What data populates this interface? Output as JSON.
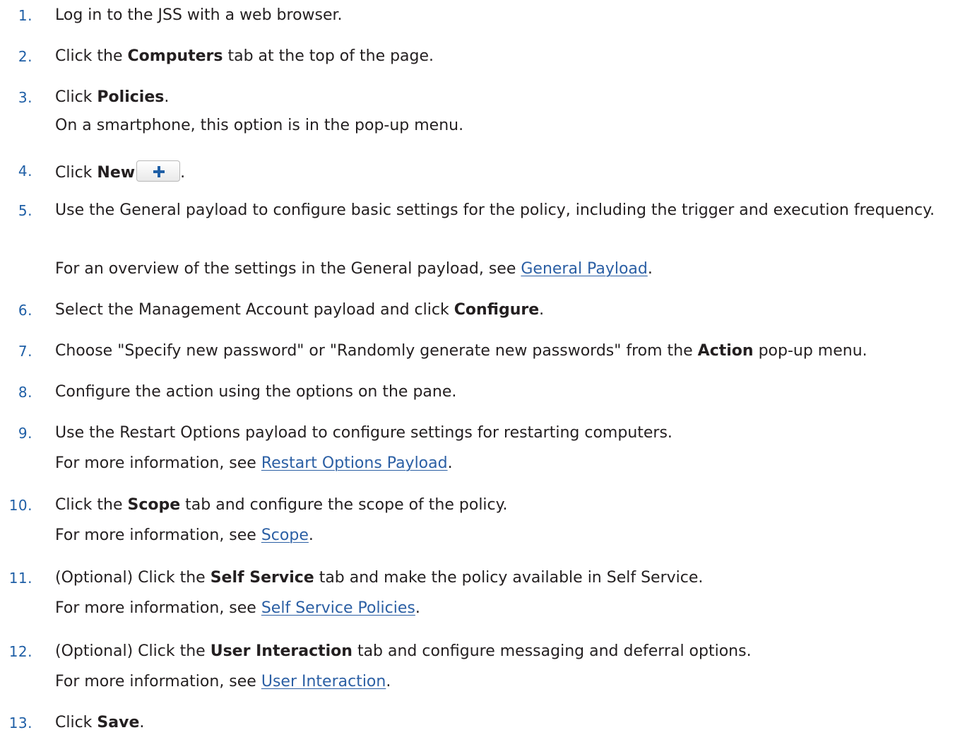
{
  "steps": [
    {
      "num": "1.",
      "text": "Log in to the JSS with a web browser."
    },
    {
      "num": "2.",
      "pre": "Click the ",
      "bold": "Computers",
      "post": " tab at the top of the page."
    },
    {
      "num": "3.",
      "pre": "Click ",
      "bold": "Policies",
      "post": ".",
      "note": "On a smartphone, this option is in the pop-up menu."
    },
    {
      "num": "4.",
      "pre": "Click ",
      "bold": "New",
      "post": ".",
      "icon": "plus-icon"
    },
    {
      "num": "5.",
      "text": "Use the General payload to configure basic settings for the policy, including the trigger and execution frequency.",
      "note_pre": "For an overview of the settings in the General payload, see ",
      "note_link": "General Payload",
      "note_post": "."
    },
    {
      "num": "6.",
      "pre": "Select the Management Account payload and click ",
      "bold": "Configure",
      "post": "."
    },
    {
      "num": "7.",
      "pre": "Choose \"Specify new password\" or \"Randomly generate new passwords\" from the ",
      "bold": "Action",
      "post": " pop-up menu."
    },
    {
      "num": "8.",
      "text": "Configure the action using the options on the pane."
    },
    {
      "num": "9.",
      "text": "Use the Restart Options payload to configure settings for restarting computers.",
      "note_pre": "For more information, see ",
      "note_link": "Restart Options Payload",
      "note_post": "."
    },
    {
      "num": "10.",
      "pre": "Click the ",
      "bold": "Scope",
      "post": " tab and configure the scope of the policy.",
      "note_pre": "For more information, see ",
      "note_link": "Scope",
      "note_post": "."
    },
    {
      "num": "11.",
      "pre": "(Optional) Click the ",
      "bold": "Self Service",
      "post": " tab and make the policy available in Self Service.",
      "note_pre": "For more information, see ",
      "note_link": "Self Service Policies",
      "note_post": "."
    },
    {
      "num": "12.",
      "pre": "(Optional) Click the ",
      "bold": "User Interaction",
      "post": " tab and configure messaging and deferral options.",
      "note_pre": "For more information, see ",
      "note_link": "User Interaction",
      "note_post": "."
    },
    {
      "num": "13.",
      "pre": "Click ",
      "bold": "Save",
      "post": "."
    }
  ],
  "colors": {
    "text": "#231f20",
    "number": "#1f5fa6",
    "link": "#2b5fa4",
    "plus_icon": "#1f5fa6"
  }
}
